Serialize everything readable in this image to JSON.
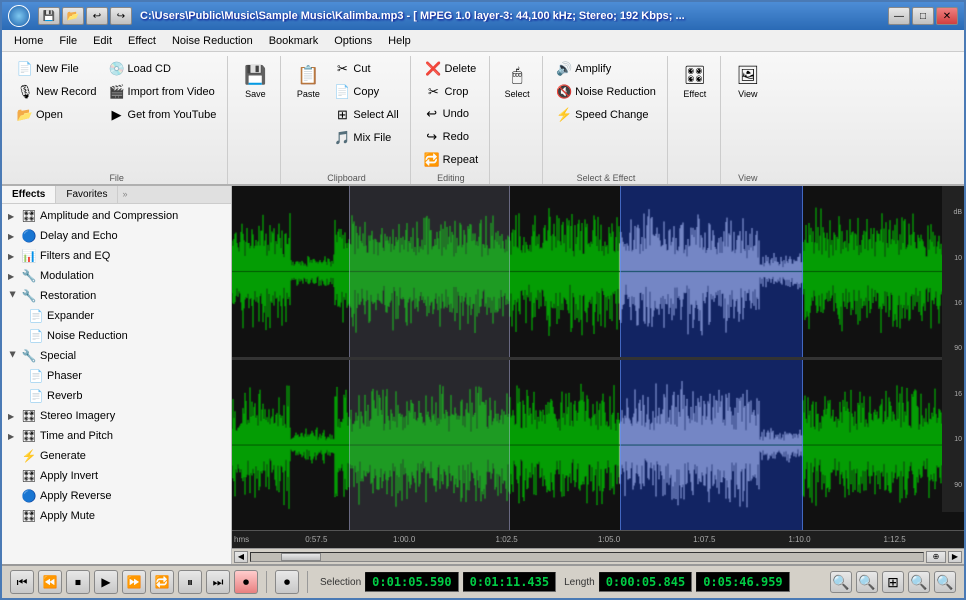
{
  "window": {
    "title": "C:\\Users\\Public\\Music\\Sample Music\\Kalimba.mp3 - [ MPEG 1.0 layer-3: 44,100 kHz; Stereo; 192 Kbps; ...",
    "min_btn": "—",
    "max_btn": "□",
    "close_btn": "✕"
  },
  "menu": {
    "items": [
      "Home",
      "File",
      "Edit",
      "Effect",
      "Noise Reduction",
      "Bookmark",
      "Options",
      "Help"
    ]
  },
  "ribbon": {
    "file_group": {
      "title": "File",
      "new_file": "New File",
      "new_record": "New Record",
      "open": "Open",
      "load_cd": "Load CD",
      "import_video": "Import from Video",
      "get_youtube": "Get from YouTube"
    },
    "save_group": {
      "title": "",
      "save": "Save"
    },
    "clipboard_group": {
      "title": "Clipboard",
      "paste": "Paste",
      "cut": "Cut",
      "copy": "Copy",
      "select_all": "Select All",
      "mix_file": "Mix File"
    },
    "editing_group": {
      "title": "Editing",
      "delete": "Delete",
      "crop": "Crop",
      "undo": "Undo",
      "redo": "Redo",
      "repeat": "Repeat"
    },
    "select_group": {
      "title": "",
      "select": "Select"
    },
    "select_effect_group": {
      "title": "Select & Effect",
      "amplify": "Amplify",
      "noise_reduction": "Noise Reduction",
      "speed_change": "Speed Change"
    },
    "effect_group": {
      "title": "",
      "effect": "Effect"
    },
    "view_group": {
      "title": "View",
      "view": "View"
    }
  },
  "sidebar": {
    "tab1": "Effects",
    "tab2": "Favorites",
    "tab_icon": "»",
    "tree": [
      {
        "id": "amplitude",
        "label": "Amplitude and Compression",
        "icon": "🎛",
        "expanded": false
      },
      {
        "id": "delay",
        "label": "Delay and Echo",
        "icon": "🔵",
        "expanded": false
      },
      {
        "id": "filters",
        "label": "Filters and EQ",
        "icon": "📊",
        "expanded": false
      },
      {
        "id": "modulation",
        "label": "Modulation",
        "icon": "🔧",
        "expanded": false
      },
      {
        "id": "restoration",
        "label": "Restoration",
        "icon": "🔧",
        "expanded": true,
        "children": [
          {
            "label": "Expander",
            "icon": "📄"
          },
          {
            "label": "Noise Reduction",
            "icon": "📄"
          }
        ]
      },
      {
        "id": "special",
        "label": "Special",
        "icon": "🔧",
        "expanded": true,
        "children": [
          {
            "label": "Phaser",
            "icon": "📄"
          },
          {
            "label": "Reverb",
            "icon": "📄"
          }
        ]
      },
      {
        "id": "stereo",
        "label": "Stereo Imagery",
        "icon": "🎛",
        "expanded": false
      },
      {
        "id": "timepitch",
        "label": "Time and Pitch",
        "icon": "🎛",
        "expanded": false
      },
      {
        "id": "generate",
        "label": "Generate",
        "icon": "⚡",
        "expanded": false
      },
      {
        "id": "invert",
        "label": "Apply Invert",
        "icon": "🎛",
        "expanded": false
      },
      {
        "id": "reverse",
        "label": "Apply Reverse",
        "icon": "🔵",
        "expanded": false
      },
      {
        "id": "mute",
        "label": "Apply Mute",
        "icon": "🎛",
        "expanded": false
      }
    ]
  },
  "transport": {
    "buttons": [
      "⏮",
      "⏪",
      "⏹",
      "▶",
      "⏩",
      "🔁",
      "⏸",
      "⏭",
      "⏺"
    ],
    "record_btn": "⏺",
    "selection_label": "Selection",
    "selection_start": "0:01:05.590",
    "selection_end": "0:01:11.435",
    "length_label": "Length",
    "length_val": "0:00:05.845",
    "total_length": "0:05:46.959"
  },
  "waveform": {
    "time_markers": [
      "hms",
      "0:57.5",
      "1:00.0",
      "1:02.5",
      "1:05.0",
      "1:07.5",
      "1:10.0",
      "1:12.5"
    ],
    "db_markers": [
      "dB",
      "10",
      "16",
      "90",
      "16",
      "10",
      "90"
    ],
    "selection_start_pct": 16,
    "selection_end_pct": 38,
    "blue_start_pct": 53,
    "blue_end_pct": 78
  }
}
